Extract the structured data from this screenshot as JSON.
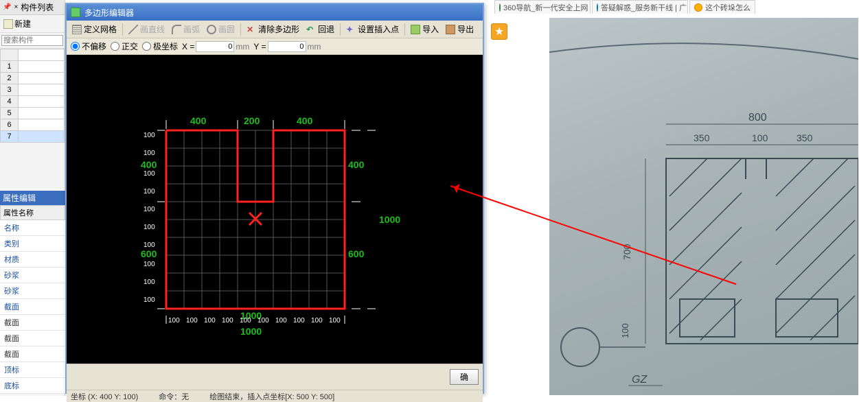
{
  "sidebar": {
    "title": "构件列表",
    "new_btn": "新建",
    "search_placeholder": "搜索构件",
    "rows": [
      "1",
      "2",
      "3",
      "4",
      "5",
      "6",
      "7"
    ]
  },
  "props": {
    "title": "属性编辑",
    "header": "属性名称",
    "items": [
      "名称",
      "类别",
      "材质",
      "砂浆",
      "砂浆",
      "截面",
      "截面",
      "截面",
      "截面",
      "顶标",
      "底标"
    ]
  },
  "editor": {
    "title": "多边形编辑器",
    "tb": {
      "define_grid": "定义网格",
      "draw_line": "画直线",
      "draw_arc": "画弧",
      "draw_circle": "画圆",
      "clear_poly": "清除多边形",
      "undo": "回退",
      "set_insert": "设置插入点",
      "import": "导入",
      "export": "导出"
    },
    "coord": {
      "no_offset": "不偏移",
      "ortho": "正交",
      "polar": "极坐标",
      "x_lbl": "X =",
      "x_val": "0",
      "x_unit": "mm",
      "y_lbl": "Y =",
      "y_val": "0",
      "y_unit": "mm"
    },
    "ok_btn": "确",
    "status": {
      "coords": "坐标 (X: 400 Y: 100)",
      "cmd": "命令：无",
      "msg": "绘图结束，插入点坐标[X: 500 Y: 500]"
    },
    "dims": {
      "top_400a": "400",
      "top_200": "200",
      "top_400b": "400",
      "left_400": "400",
      "left_600": "600",
      "right_400": "400",
      "right_600": "600",
      "right_1000": "1000",
      "bot_1000a": "1000",
      "bot_1000b": "1000",
      "tick_100": "100"
    }
  },
  "tabs": {
    "t1": "360导航_新一代安全上网",
    "t2": "答疑解惑_服务新干线 | 广",
    "t3": "这个砖垛怎么"
  },
  "photo": {
    "d800": "800",
    "d350a": "350",
    "d100": "100",
    "d350b": "350",
    "d700": "700",
    "d100v": "100",
    "gz": "GZ"
  }
}
